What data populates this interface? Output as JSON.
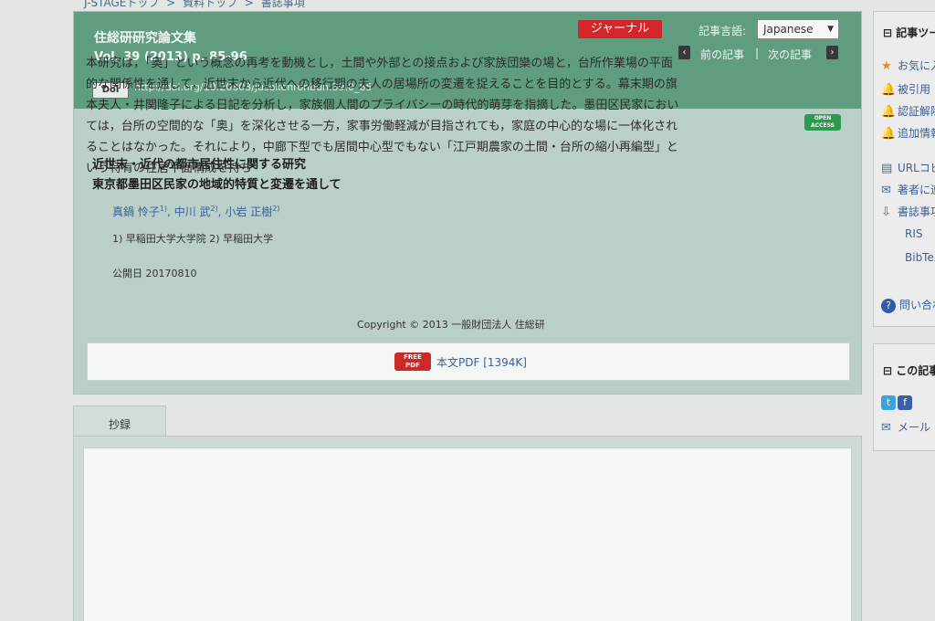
{
  "breadcrumb": [
    "J-STAGEトップ",
    ">",
    "資料トップ",
    ">",
    "書誌事項"
  ],
  "header": {
    "journal_name": "住総研研究論文集",
    "volume_info": "Vol. 39 (2013) p. 85-96",
    "doi_badge": "Doi",
    "doi_url": "http://doi.org/10.20803/jusokenronbun.39.0_85",
    "journal_badge": "ジャーナル",
    "language_label": "記事言語:",
    "language_value": "Japanese",
    "prev_article": "前の記事",
    "separator": "|",
    "next_article": "次の記事"
  },
  "article": {
    "open_access": "OPEN ACCESS",
    "title_line1": "近世末・近代の都市居住性に関する研究",
    "title_line2": "東京都墨田区民家の地域的特質と変遷を通して",
    "authors": [
      {
        "name": "真鍋 怜子",
        "sup": "1)"
      },
      {
        "name": "中川 武",
        "sup": "2)"
      },
      {
        "name": "小岩 正樹",
        "sup": "2)"
      }
    ],
    "affiliations": "1) 早稲田大学大学院 2) 早稲田大学",
    "published": "公開日 20170810",
    "copyright": "Copyright © 2013 一般財団法人 住総研",
    "pdf_icon_top": "FREE",
    "pdf_icon_bottom": "PDF",
    "pdf_link": "本文PDF [1394K]"
  },
  "abstract": {
    "tab_label": "抄録",
    "text": "本研究は，「奥」という概念の再考を動機とし，土間や外部との接点および家族団欒の場と，台所作業場の平面的な関係性を通して，近世末から近代への移行期の夫人の居場所の変遷を捉えることを目的とする。幕末期の旗本夫人・井関隆子による日記を分析し，家族個人間のプライバシーの時代的萌芽を指摘した。墨田区民家においては，台所の空間的な「奥」を深化させる一方，家事労働軽減が目指されても，家庭の中心的な場に一体化されることはなかった。それにより，中廊下型でも居間中心型でもない「江戸期農家の土間・台所の縮小再編型」という特有の住居平面構成を持ち"
  },
  "sidebar": {
    "tools_heading": "記事ツール",
    "items": [
      "お気に入り",
      "被引用",
      "認証解除",
      "追加情報",
      "URLコピー",
      "著者に連絡",
      "書誌事項",
      "RIS",
      "BibTeX",
      "問い合わせ"
    ],
    "share_heading": "この記事を共有",
    "share_mail": "メール"
  },
  "icons": {
    "star": "star-icon",
    "bell": "bell-icon",
    "document": "document-icon",
    "mail": "mail-icon",
    "download": "download-icon",
    "help": "help-icon",
    "twitter": "twitter-icon",
    "facebook": "facebook-icon"
  },
  "colors": {
    "header_green": "#5f9c80",
    "panel_green": "#b9cfc7",
    "journal_red": "#d4252b",
    "link_blue": "#3a5f99",
    "open_access_green": "#2e9a4d"
  }
}
